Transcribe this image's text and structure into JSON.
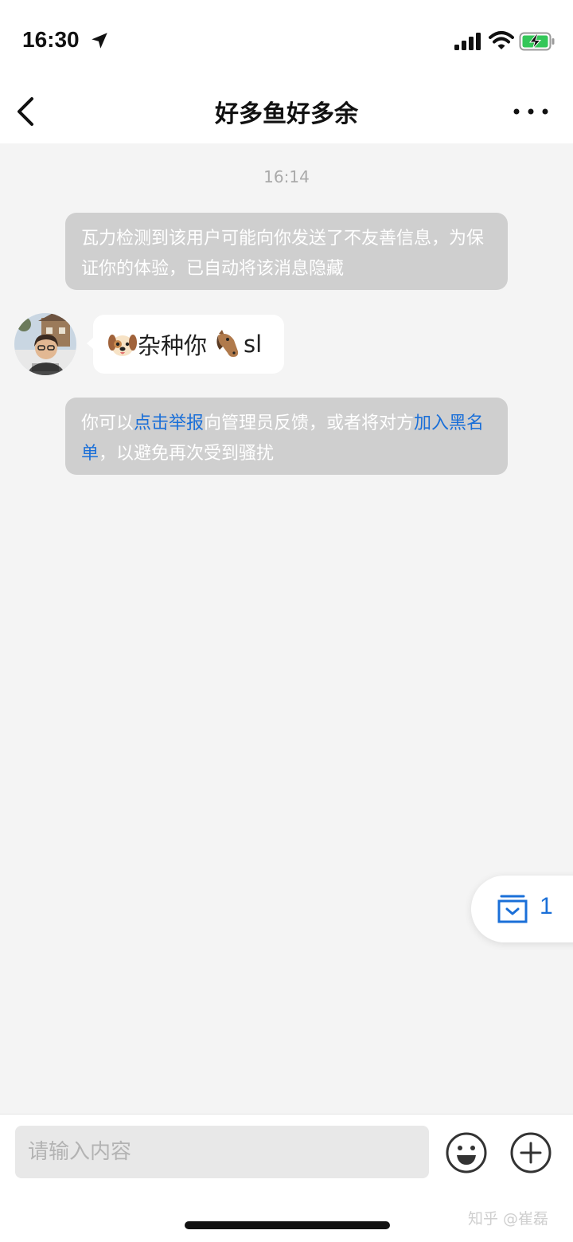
{
  "status_bar": {
    "time": "16:30",
    "icons": [
      "location-arrow-icon",
      "cellular-signal-icon",
      "wifi-icon",
      "battery-charging-icon"
    ]
  },
  "nav": {
    "title": "好多鱼好多余",
    "back_icon": "chevron-left-icon",
    "more_icon": "more-dots-icon"
  },
  "chat": {
    "timestamp": "16:14",
    "system_notice_1": "瓦力检测到该用户可能向你发送了不友善信息，为保证你的体验，已自动将该消息隐藏",
    "message": {
      "sender_avatar": "avatar",
      "emoji_1": "dog-face-emoji",
      "text_1": "杂种你",
      "emoji_2": "horse-face-emoji",
      "text_2": "sl"
    },
    "system_notice_2": {
      "part_1": "你可以",
      "link_report": "点击举报",
      "part_2": "向管理员反馈，或者将对方",
      "link_block": "加入黑名单",
      "part_3": "，以避免再次受到骚扰"
    }
  },
  "float_badge": {
    "icon": "archive-box-icon",
    "count": "1",
    "accent_color": "#1a6fd8"
  },
  "input_bar": {
    "placeholder": "请输入内容",
    "emoji_icon": "smiley-icon",
    "plus_icon": "plus-circle-icon"
  },
  "watermark": "知乎 @崔磊"
}
